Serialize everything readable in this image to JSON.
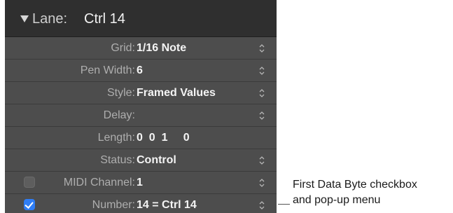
{
  "lane": {
    "label": "Lane:",
    "value": "Ctrl 14"
  },
  "rows": [
    {
      "label": "Grid:",
      "value": "1/16 Note",
      "stepper": true
    },
    {
      "label": "Pen Width:",
      "value": "6",
      "stepper": true
    },
    {
      "label": "Style:",
      "value": "Framed Values",
      "stepper": true
    },
    {
      "label": "Delay:",
      "value": "",
      "stepper": true
    },
    {
      "label": "Length:",
      "value": "0  0  1     0",
      "stepper": false
    },
    {
      "label": "Status:",
      "value": "Control",
      "stepper": true
    },
    {
      "label": "MIDI Channel:",
      "value": "1",
      "stepper": true,
      "checkbox": false
    },
    {
      "label": "Number:",
      "value": "14 = Ctrl 14",
      "stepper": true,
      "checkbox": true
    }
  ],
  "callout": {
    "line1": "First Data Byte checkbox",
    "line2": "and pop-up menu"
  },
  "colors": {
    "panel_bg": "#4d4d4d",
    "header_bg": "#2f2f2f",
    "checkbox_on": "#2f7ef6"
  }
}
